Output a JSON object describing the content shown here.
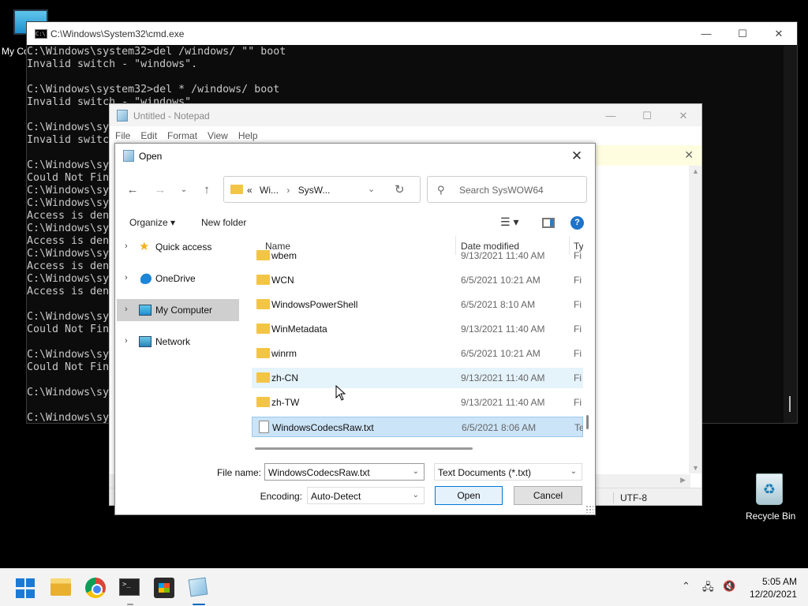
{
  "desktop": {
    "my_computer_label": "My Co",
    "recycle_bin_label": "Recycle Bin"
  },
  "cmd": {
    "title": "C:\\Windows\\System32\\cmd.exe",
    "lines": [
      "C:\\Windows\\system32>del /windows/ \"\" boot",
      "Invalid switch - \"windows\".",
      "",
      "C:\\Windows\\system32>del * /windows/ boot",
      "Invalid switch - \"windows\".",
      "",
      "C:\\Windows\\sy",
      "Invalid switc",
      "",
      "C:\\Windows\\sy",
      "Could Not Fin",
      "C:\\Windows\\sy",
      "C:\\Windows\\sy",
      "Access is den",
      "C:\\Windows\\sy",
      "Access is den",
      "C:\\Windows\\sy",
      "Access is den",
      "C:\\Windows\\sy",
      "Access is den",
      "",
      "C:\\Windows\\sy",
      "Could Not Fin",
      "",
      "C:\\Windows\\sy",
      "Could Not Fin",
      "",
      "C:\\Windows\\sy",
      "",
      "C:\\Windows\\sy"
    ]
  },
  "notepad": {
    "title": "Untitled - Notepad",
    "menu": [
      "File",
      "Edit",
      "Format",
      "View",
      "Help"
    ],
    "encoding_status": "UTF-8"
  },
  "dialog": {
    "title": "Open",
    "breadcrumb": {
      "prefix": "«",
      "items": [
        "Wi...",
        "SysW..."
      ]
    },
    "search_placeholder": "Search SysWOW64",
    "toolbar": {
      "organize": "Organize ▾",
      "new_folder": "New folder"
    },
    "nav_items": [
      {
        "label": "Quick access",
        "icon": "star-icon",
        "selected": false
      },
      {
        "label": "OneDrive",
        "icon": "cloud-icon",
        "selected": false
      },
      {
        "label": "My Computer",
        "icon": "computer-icon",
        "selected": true
      },
      {
        "label": "Network",
        "icon": "network-icon",
        "selected": false
      }
    ],
    "columns": [
      "Name",
      "Date modified",
      "Ty"
    ],
    "files": [
      {
        "name": "wbem",
        "date": "9/13/2021 11:40 AM",
        "type": "Fi",
        "kind": "folder",
        "state": ""
      },
      {
        "name": "WCN",
        "date": "6/5/2021 10:21 AM",
        "type": "Fi",
        "kind": "folder",
        "state": ""
      },
      {
        "name": "WindowsPowerShell",
        "date": "6/5/2021 8:10 AM",
        "type": "Fi",
        "kind": "folder",
        "state": ""
      },
      {
        "name": "WinMetadata",
        "date": "9/13/2021 11:40 AM",
        "type": "Fi",
        "kind": "folder",
        "state": ""
      },
      {
        "name": "winrm",
        "date": "6/5/2021 10:21 AM",
        "type": "Fi",
        "kind": "folder",
        "state": ""
      },
      {
        "name": "zh-CN",
        "date": "9/13/2021 11:40 AM",
        "type": "Fi",
        "kind": "folder",
        "state": "hover"
      },
      {
        "name": "zh-TW",
        "date": "9/13/2021 11:40 AM",
        "type": "Fi",
        "kind": "folder",
        "state": ""
      },
      {
        "name": "WindowsCodecsRaw.txt",
        "date": "6/5/2021 8:06 AM",
        "type": "Te",
        "kind": "file",
        "state": "selected"
      }
    ],
    "file_name_label": "File name:",
    "file_name_value": "WindowsCodecsRaw.txt",
    "file_type_value": "Text Documents (*.txt)",
    "encoding_label": "Encoding:",
    "encoding_value": "Auto-Detect",
    "open_button": "Open",
    "cancel_button": "Cancel"
  },
  "taskbar": {
    "apps": [
      "start-icon",
      "file-explorer-icon",
      "chrome-icon",
      "terminal-icon",
      "store-icon",
      "notepad-icon"
    ],
    "time": "5:05 AM",
    "date": "12/20/2021"
  }
}
